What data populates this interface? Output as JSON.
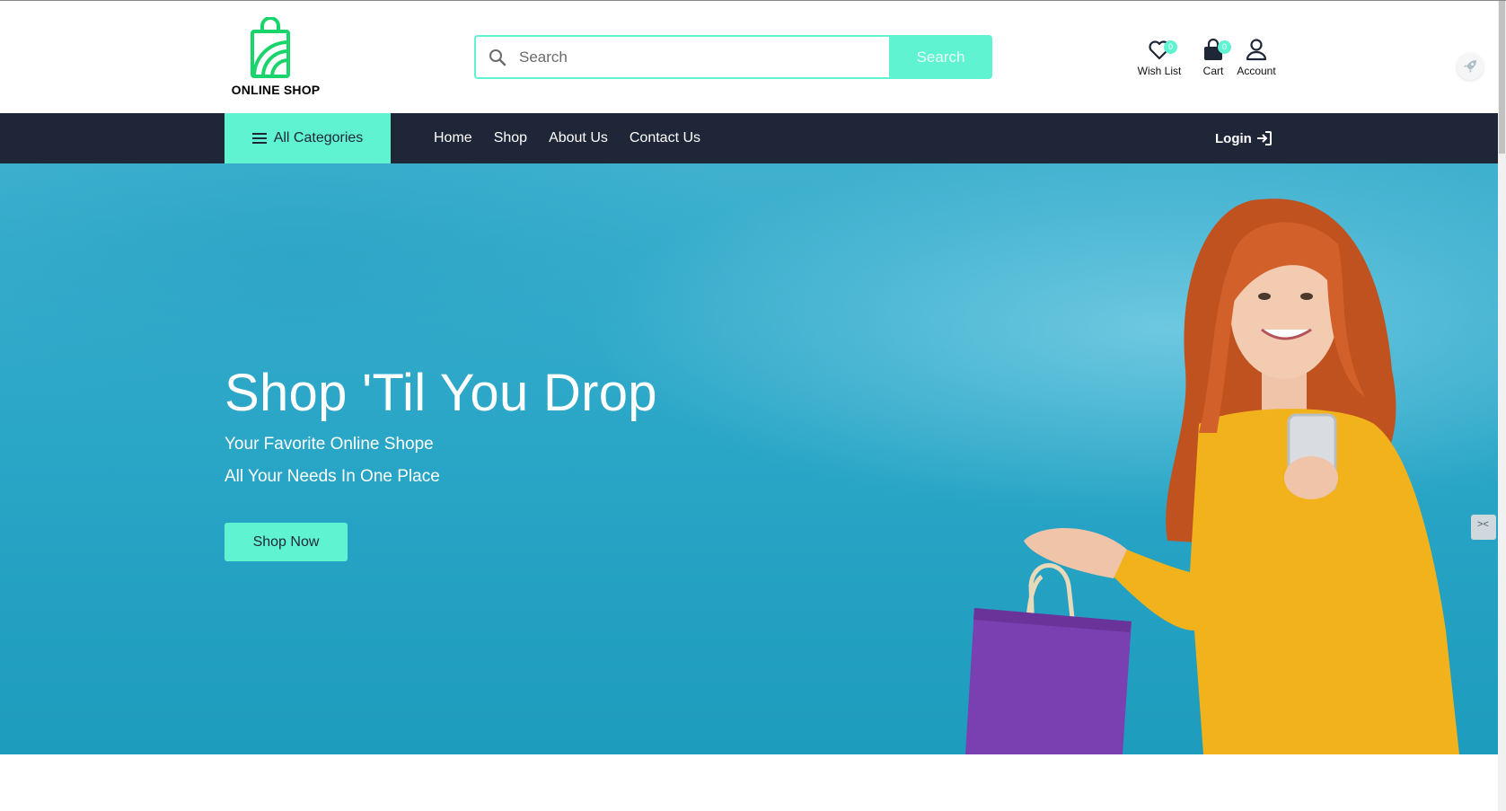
{
  "brand": {
    "logo_text": "ONLINE SHOP",
    "accent_color": "#5ff3d1",
    "logo_color": "#19d46a",
    "nav_bg": "#1f2638"
  },
  "search": {
    "placeholder": "Search",
    "value": "",
    "button_label": "Search"
  },
  "header_actions": {
    "wishlist": {
      "label": "Wish List",
      "count": "0",
      "icon": "heart-icon"
    },
    "cart": {
      "label": "Cart",
      "count": "0",
      "icon": "shopping-bag-icon"
    },
    "account": {
      "label": "Account",
      "icon": "user-icon"
    }
  },
  "nav": {
    "all_categories": "All Categories",
    "links": [
      "Home",
      "Shop",
      "About Us",
      "Contact Us"
    ],
    "login_label": "Login"
  },
  "hero": {
    "title": "Shop 'Til You Drop",
    "subtitle_1": "Your Favorite Online Shope",
    "subtitle_2": "All Your Needs In One Place",
    "cta_label": "Shop Now"
  }
}
